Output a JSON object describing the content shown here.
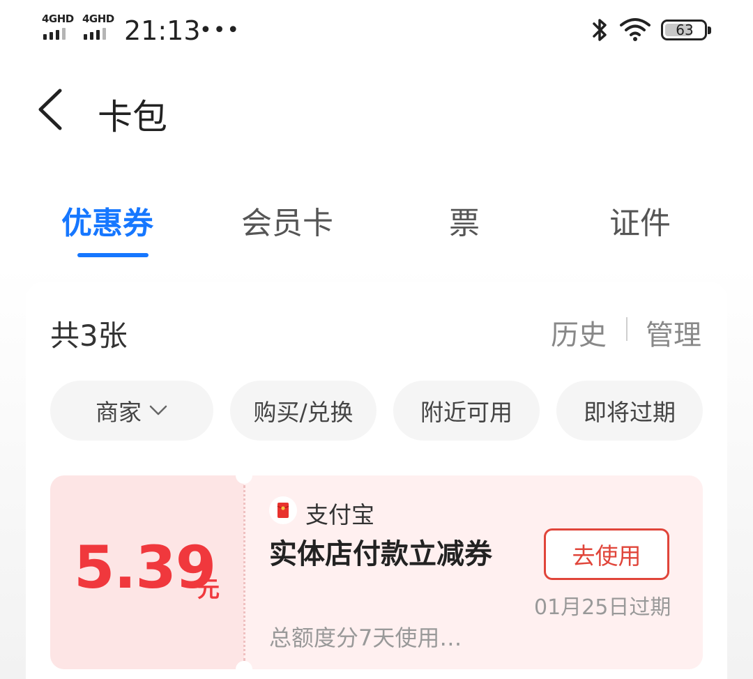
{
  "status_bar": {
    "network_1": "4GHD",
    "network_2": "4GHD",
    "time": "21:13",
    "more": "•••",
    "battery": "63"
  },
  "header": {
    "title": "卡包"
  },
  "tabs": [
    {
      "label": "优惠券",
      "active": true
    },
    {
      "label": "会员卡",
      "active": false
    },
    {
      "label": "票",
      "active": false
    },
    {
      "label": "证件",
      "active": false
    }
  ],
  "summary": {
    "count": "共3张",
    "history": "历史",
    "manage": "管理"
  },
  "filters": [
    {
      "label": "商家"
    },
    {
      "label": "购买/兑换"
    },
    {
      "label": "附近可用"
    },
    {
      "label": "即将过期"
    }
  ],
  "coupon": {
    "amount": "5.39",
    "unit": "元",
    "merchant": "支付宝",
    "title": "实体店付款立减券",
    "description": "总额度分7天使用…",
    "use_label": "去使用",
    "expire": "01月25日过期"
  },
  "colors": {
    "accent": "#1677ff",
    "coupon_red": "#f0383d"
  }
}
